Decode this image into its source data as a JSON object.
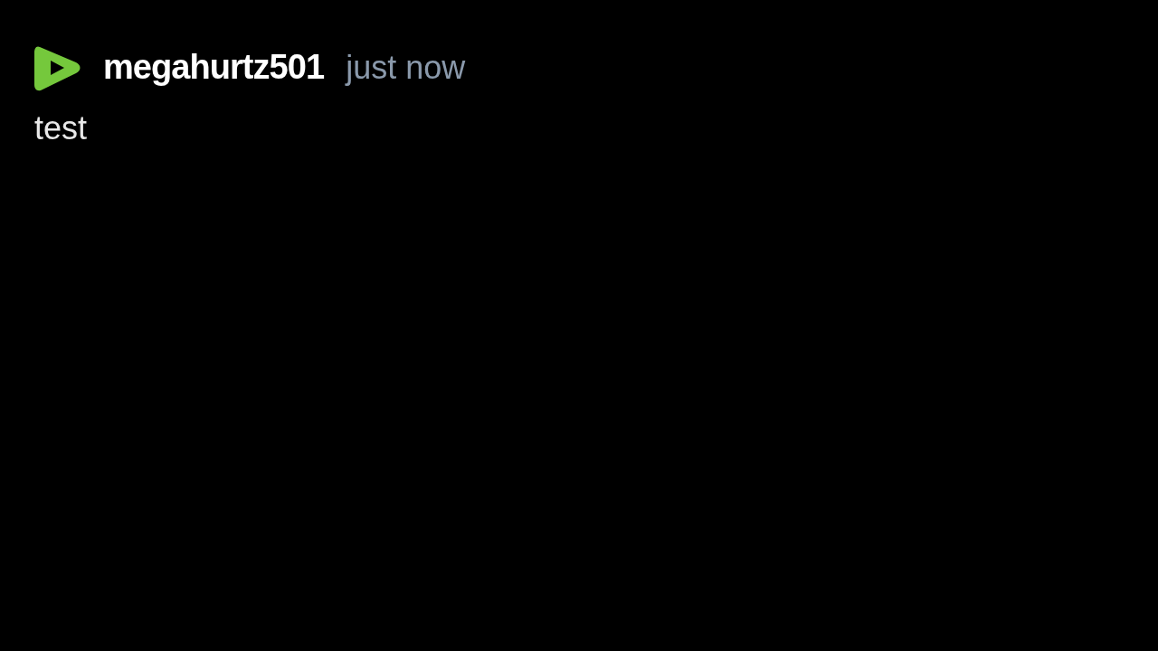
{
  "message": {
    "username": "megahurtz501",
    "time": "just now",
    "text": "test"
  }
}
